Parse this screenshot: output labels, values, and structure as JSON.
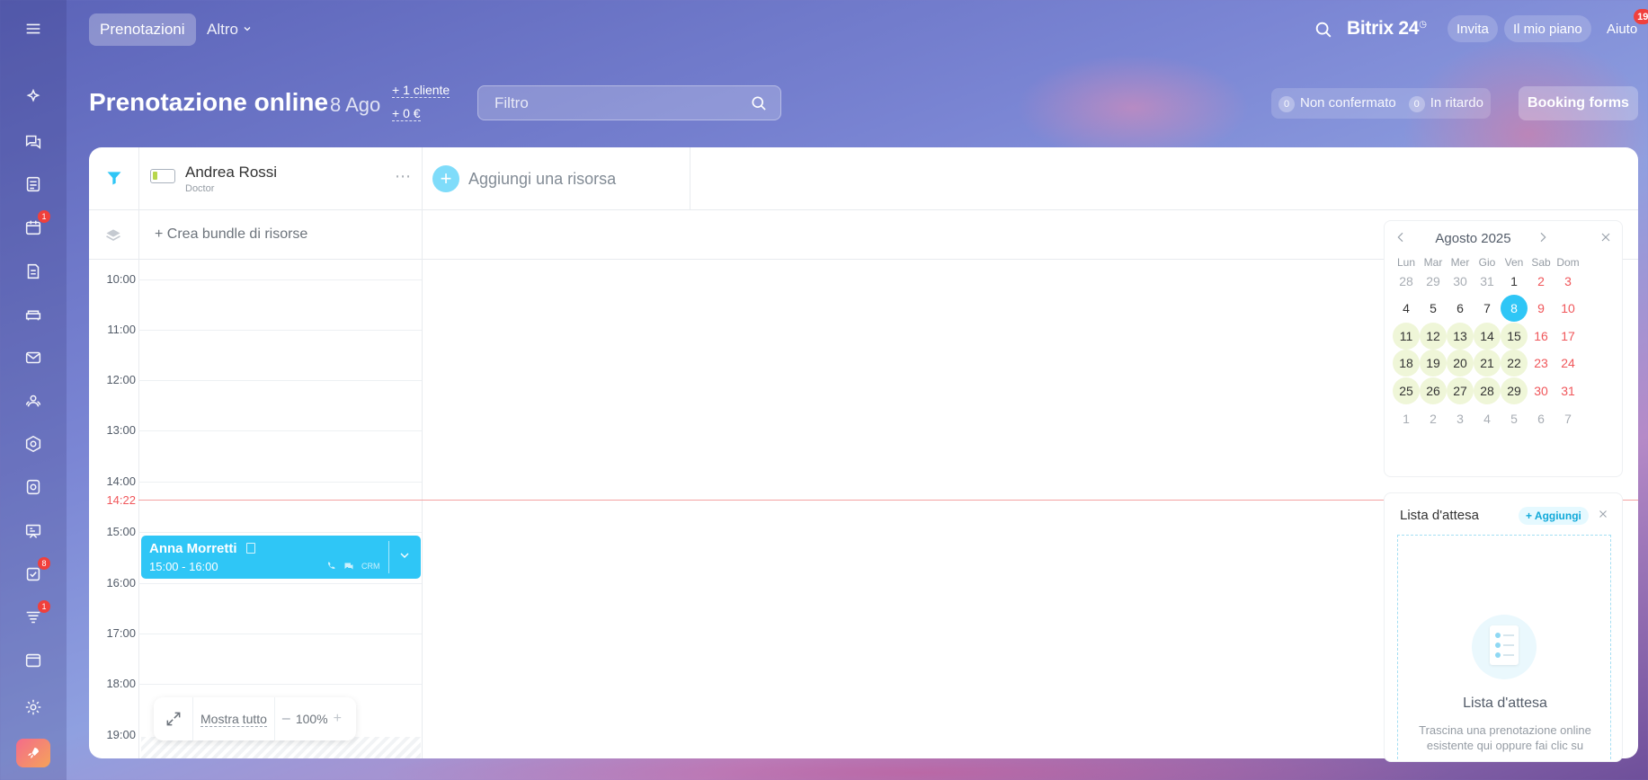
{
  "topbar": {
    "tabs": [
      {
        "label": "Prenotazioni"
      },
      {
        "label": "Altro"
      }
    ],
    "brand": "Bitrix 24",
    "invite_label": "Invita",
    "plan_label": "Il mio piano",
    "help_label": "Aiuto",
    "help_badge": "19"
  },
  "rail": {
    "badges": {
      "calendar": "1",
      "tasks": "8",
      "feed": "1"
    }
  },
  "header": {
    "title": "Prenotazione online",
    "date": "8 Ago",
    "stat_clients": "+ 1 cliente",
    "stat_amount": "+ 0 €",
    "filter_placeholder": "Filtro",
    "unconfirmed_count": "0",
    "unconfirmed_label": "Non confermato",
    "late_count": "0",
    "late_label": "In ritardo",
    "booking_forms_label": "Booking forms"
  },
  "resources": {
    "name": "Andrea Rossi",
    "role": "Doctor",
    "add_label": "Aggiungi una risorsa",
    "bundle_label": "Crea bundle di risorse"
  },
  "timeline": {
    "hours": [
      "10:00",
      "11:00",
      "12:00",
      "13:00",
      "14:00",
      "15:00",
      "16:00",
      "17:00",
      "18:00",
      "19:00"
    ],
    "now": "14:22"
  },
  "booking": {
    "client": "Anna Morretti",
    "time": "15:00 - 16:00",
    "crm_label": "CRM"
  },
  "zoom": {
    "show_all": "Mostra tutto",
    "minus": "–",
    "value": "100%",
    "plus": "+"
  },
  "calendar": {
    "month": "Agosto 2025",
    "weekdays": [
      "Lun",
      "Mar",
      "Mer",
      "Gio",
      "Ven",
      "Sab",
      "Dom"
    ],
    "weeks": [
      [
        "28",
        "29",
        "30",
        "31",
        "1",
        "2",
        "3"
      ],
      [
        "4",
        "5",
        "6",
        "7",
        "8",
        "9",
        "10"
      ],
      [
        "11",
        "12",
        "13",
        "14",
        "15",
        "16",
        "17"
      ],
      [
        "18",
        "19",
        "20",
        "21",
        "22",
        "23",
        "24"
      ],
      [
        "25",
        "26",
        "27",
        "28",
        "29",
        "30",
        "31"
      ],
      [
        "1",
        "2",
        "3",
        "4",
        "5",
        "6",
        "7"
      ]
    ],
    "today": "8",
    "accent": "#2fc6f6"
  },
  "waitlist": {
    "title": "Lista d'attesa",
    "add_label": "+ Aggiungi",
    "empty_title": "Lista d'attesa",
    "empty_text": "Trascina una prenotazione online esistente qui oppure fai clic su"
  },
  "icons": {
    "menu": "hamburger-icon",
    "search": "search-icon",
    "filter": "funnel-icon",
    "settings": "gear-icon"
  }
}
